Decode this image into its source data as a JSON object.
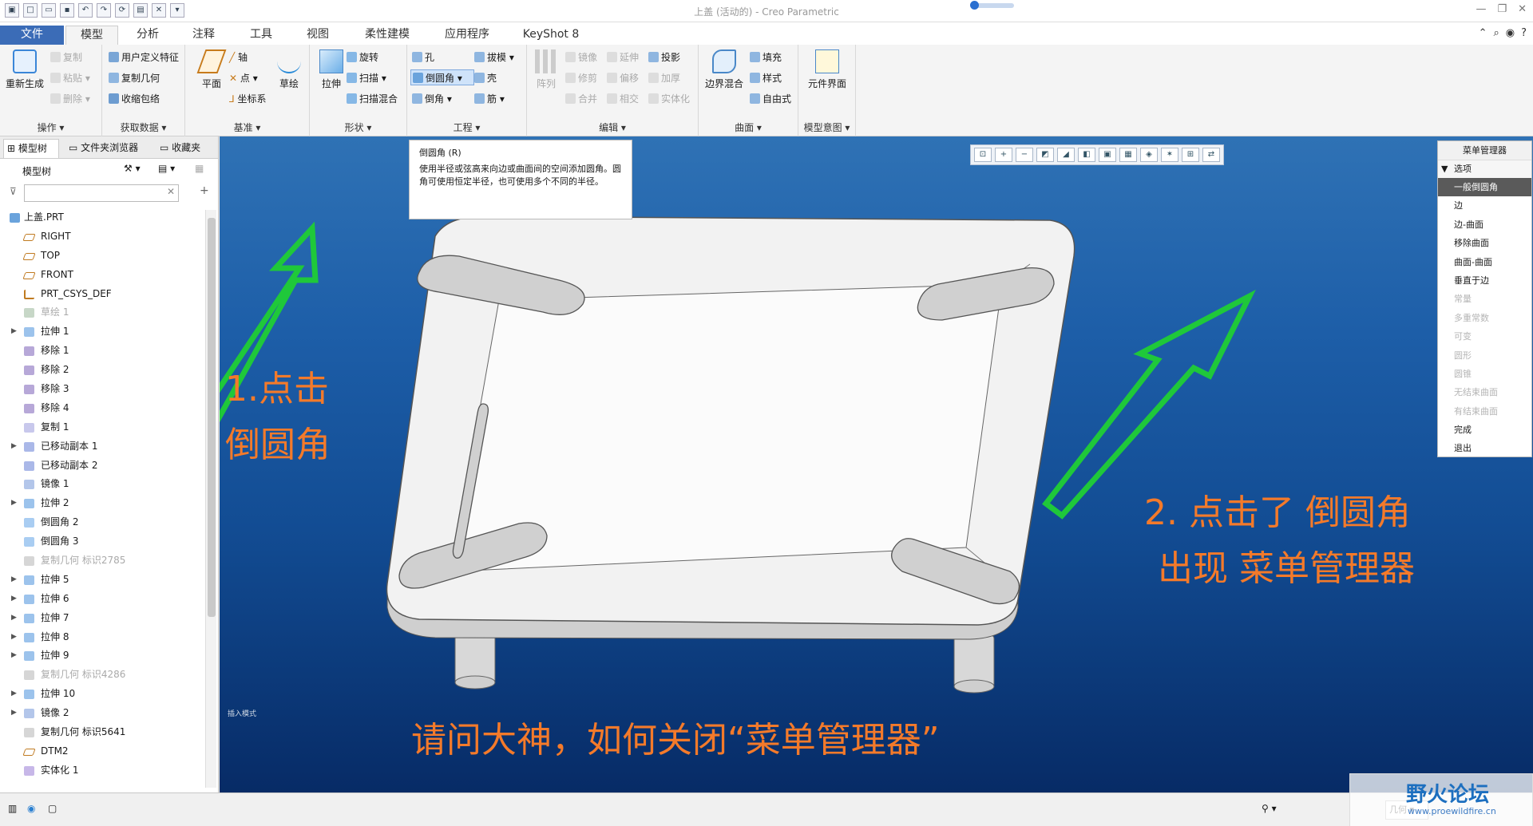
{
  "window": {
    "title": "上盖 (活动的) - Creo Parametric"
  },
  "tabs": [
    "文件",
    "模型",
    "分析",
    "注释",
    "工具",
    "视图",
    "柔性建模",
    "应用程序",
    "KeyShot 8"
  ],
  "ribbon": {
    "operations": {
      "regenerate": "重新生成",
      "copy": "复制",
      "paste": "粘贴",
      "delete": "删除",
      "group": "操作"
    },
    "get_data": {
      "udf": "用户定义特征",
      "copy_geom": "复制几何",
      "shrinkwrap": "收缩包络",
      "group": "获取数据"
    },
    "datum": {
      "plane": "平面",
      "axis": "轴",
      "point": "点",
      "csys": "坐标系",
      "sketch": "草绘",
      "group": "基准"
    },
    "shapes": {
      "extrude": "拉伸",
      "revolve": "旋转",
      "sweep": "扫描",
      "swept_blend": "扫描混合",
      "group": "形状"
    },
    "engineering": {
      "hole": "孔",
      "round": "倒圆角",
      "chamfer": "倒角",
      "draft": "拔模",
      "shell": "壳",
      "rib": "筋",
      "group": "工程"
    },
    "editing": {
      "pattern": "阵列",
      "mirror": "镜像",
      "extend": "延伸",
      "project": "投影",
      "trim": "修剪",
      "offset": "偏移",
      "thicken": "加厚",
      "merge": "合并",
      "intersect": "相交",
      "solidify": "实体化",
      "group": "编辑"
    },
    "surfaces": {
      "boundary_blend": "边界混合",
      "fill": "填充",
      "style": "样式",
      "freestyle": "自由式",
      "group": "曲面"
    },
    "model_intent": {
      "component_interface": "元件界面",
      "group": "模型意图"
    }
  },
  "left_panel": {
    "tabs": [
      "模型树",
      "文件夹浏览器",
      "收藏夹"
    ],
    "header": "模型树",
    "tree": [
      {
        "label": "上盖.PRT",
        "expand": false,
        "icon": "part-icon",
        "gray": false,
        "root": true
      },
      {
        "label": "RIGHT",
        "expand": false,
        "icon": "datum-plane-icon",
        "gray": false
      },
      {
        "label": "TOP",
        "expand": false,
        "icon": "datum-plane-icon",
        "gray": false
      },
      {
        "label": "FRONT",
        "expand": false,
        "icon": "datum-plane-icon",
        "gray": false
      },
      {
        "label": "PRT_CSYS_DEF",
        "expand": false,
        "icon": "csys-icon",
        "gray": false
      },
      {
        "label": "草绘 1",
        "expand": false,
        "icon": "sketch-icon",
        "gray": true
      },
      {
        "label": "拉伸 1",
        "expand": true,
        "icon": "extrude-icon",
        "gray": false
      },
      {
        "label": "移除 1",
        "expand": false,
        "icon": "remove-icon",
        "gray": false
      },
      {
        "label": "移除 2",
        "expand": false,
        "icon": "remove-icon",
        "gray": false
      },
      {
        "label": "移除 3",
        "expand": false,
        "icon": "remove-icon",
        "gray": false
      },
      {
        "label": "移除 4",
        "expand": false,
        "icon": "remove-icon",
        "gray": false
      },
      {
        "label": "复制 1",
        "expand": false,
        "icon": "copy-icon",
        "gray": false
      },
      {
        "label": "已移动副本 1",
        "expand": true,
        "icon": "moved-copy-icon",
        "gray": false
      },
      {
        "label": "已移动副本 2",
        "expand": false,
        "icon": "moved-copy-icon",
        "gray": false
      },
      {
        "label": "镜像 1",
        "expand": false,
        "icon": "mirror-icon",
        "gray": false
      },
      {
        "label": "拉伸 2",
        "expand": true,
        "icon": "extrude-icon",
        "gray": false
      },
      {
        "label": "倒圆角 2",
        "expand": false,
        "icon": "round-icon",
        "gray": false
      },
      {
        "label": "倒圆角 3",
        "expand": false,
        "icon": "round-icon",
        "gray": false
      },
      {
        "label": "复制几何 标识2785",
        "expand": false,
        "icon": "copy-geom-icon",
        "gray": true
      },
      {
        "label": "拉伸 5",
        "expand": true,
        "icon": "extrude-icon",
        "gray": false
      },
      {
        "label": "拉伸 6",
        "expand": true,
        "icon": "extrude-icon",
        "gray": false
      },
      {
        "label": "拉伸 7",
        "expand": true,
        "icon": "extrude-icon",
        "gray": false
      },
      {
        "label": "拉伸 8",
        "expand": true,
        "icon": "extrude-icon",
        "gray": false
      },
      {
        "label": "拉伸 9",
        "expand": true,
        "icon": "extrude-icon",
        "gray": false
      },
      {
        "label": "复制几何 标识4286",
        "expand": false,
        "icon": "copy-geom-icon",
        "gray": true
      },
      {
        "label": "拉伸 10",
        "expand": true,
        "icon": "extrude-icon",
        "gray": false
      },
      {
        "label": "镜像 2",
        "expand": true,
        "icon": "mirror-icon",
        "gray": false
      },
      {
        "label": "复制几何 标识5641",
        "expand": false,
        "icon": "copy-geom-icon",
        "gray": false
      },
      {
        "label": "DTM2",
        "expand": false,
        "icon": "datum-plane-icon",
        "gray": false
      },
      {
        "label": "实体化 1",
        "expand": false,
        "icon": "solidify-icon",
        "gray": false
      }
    ]
  },
  "tooltip": {
    "title": "倒圆角 (R)",
    "body": "使用半径或弦高来向边或曲面间的空间添加圆角。圆角可使用恒定半径，也可使用多个不同的半径。"
  },
  "menu_manager": {
    "title": "菜单管理器",
    "section": "选项",
    "items": [
      {
        "label": "一般倒圆角",
        "state": "selected"
      },
      {
        "label": "边",
        "state": "normal"
      },
      {
        "label": "边-曲面",
        "state": "normal"
      },
      {
        "label": "移除曲面",
        "state": "normal"
      },
      {
        "label": "曲面-曲面",
        "state": "normal"
      },
      {
        "label": "垂直于边",
        "state": "normal"
      },
      {
        "label": "常量",
        "state": "disabled"
      },
      {
        "label": "多重常数",
        "state": "disabled"
      },
      {
        "label": "可变",
        "state": "disabled"
      },
      {
        "label": "圆形",
        "state": "disabled"
      },
      {
        "label": "圆锥",
        "state": "disabled"
      },
      {
        "label": "无结束曲面",
        "state": "disabled"
      },
      {
        "label": "有结束曲面",
        "state": "disabled"
      },
      {
        "label": "完成",
        "state": "normal"
      },
      {
        "label": "退出",
        "state": "normal"
      }
    ]
  },
  "annotations": {
    "a1_line1": "1.点击",
    "a1_line2": "倒圆角",
    "a2_line1": "2.  点击了  倒圆角",
    "a2_line2": "出现 菜单管理器",
    "question": "请问大神，如何关闭“菜单管理器”"
  },
  "viewport": {
    "small_label": "插入模式"
  },
  "status": {
    "filter": "几何"
  },
  "watermark": {
    "name": "野火论坛",
    "url": "www.proewildfire.cn"
  },
  "colors": {
    "accent": "#3b6cb7",
    "annotation": "#f47a2a",
    "arrow": "#1fc83a",
    "viewport_top": "#2f72b5",
    "viewport_bottom": "#072b66"
  }
}
